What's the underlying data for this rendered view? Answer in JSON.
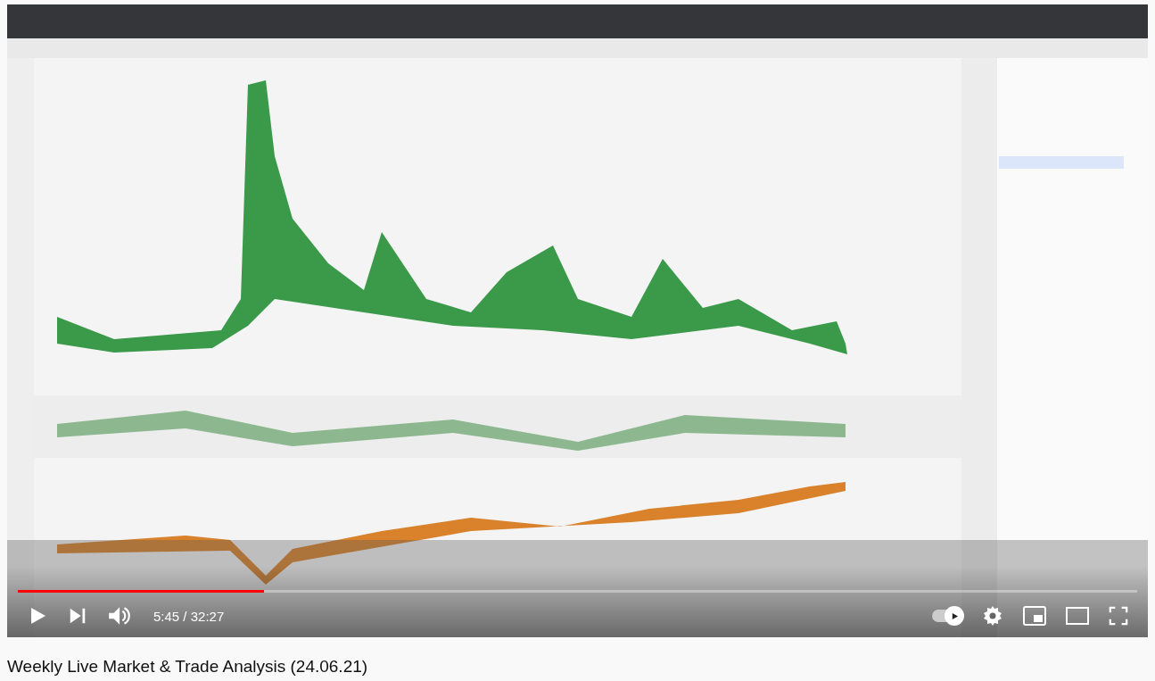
{
  "player": {
    "kind": "picture",
    "progress": {
      "level": 0.22
    },
    "time": "5:45 / 32:27",
    "autoplay": {
      "on": true
    }
  },
  "video_title": "Weekly Live Market & Trade Analysis (24.06.21)"
}
